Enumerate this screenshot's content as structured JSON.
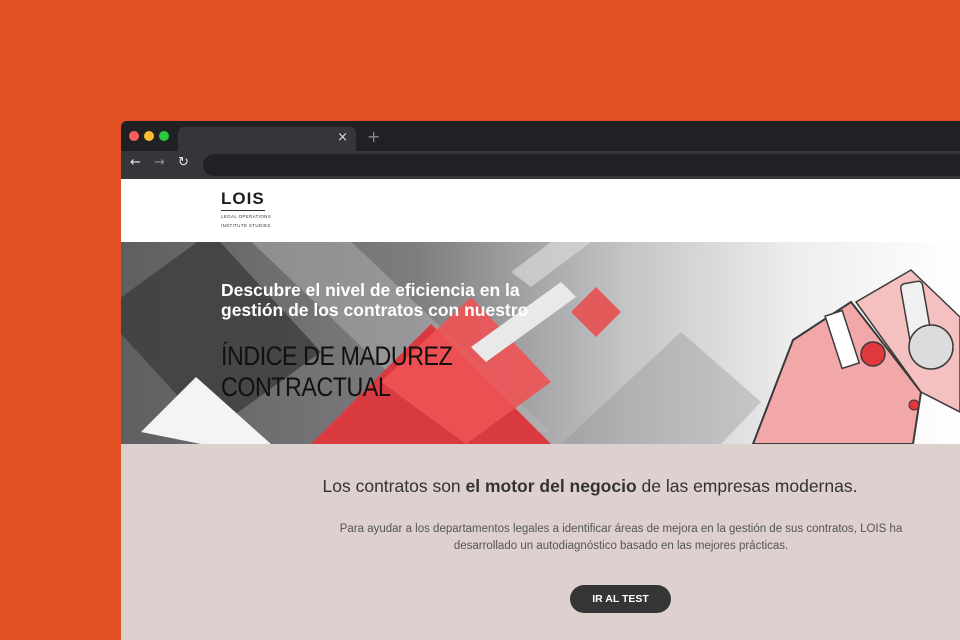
{
  "browser": {
    "tab_close": "×",
    "new_tab": "+",
    "nav": {
      "back": "←",
      "forward": "→",
      "reload": "↻"
    }
  },
  "logo": {
    "word": "LOIS",
    "line1": "LEGAL OPERATIONS",
    "line2": "INSTITUTE STUDIES"
  },
  "hero": {
    "lead": "Descubre el nivel de eficiencia en la gestión de los contratos con nuestro",
    "title": "ÍNDICE DE MADUREZ CONTRACTUAL"
  },
  "intro": {
    "headline_pre": "Los contratos son ",
    "headline_bold": "el motor del negocio",
    "headline_post": " de las empresas modernas.",
    "body": "Para ayudar a los departamentos legales a identificar áreas de mejora en la gestión de sus contratos, LOIS ha desarrollado un autodiagnóstico basado en las mejores prácticas.",
    "cta": "IR AL TEST"
  },
  "colors": {
    "page_background": "#e24f22",
    "accent_red": "#e63c3c",
    "hero_pink": "#f2a8a8",
    "section_background": "#ddd0cf",
    "button": "#353535"
  }
}
